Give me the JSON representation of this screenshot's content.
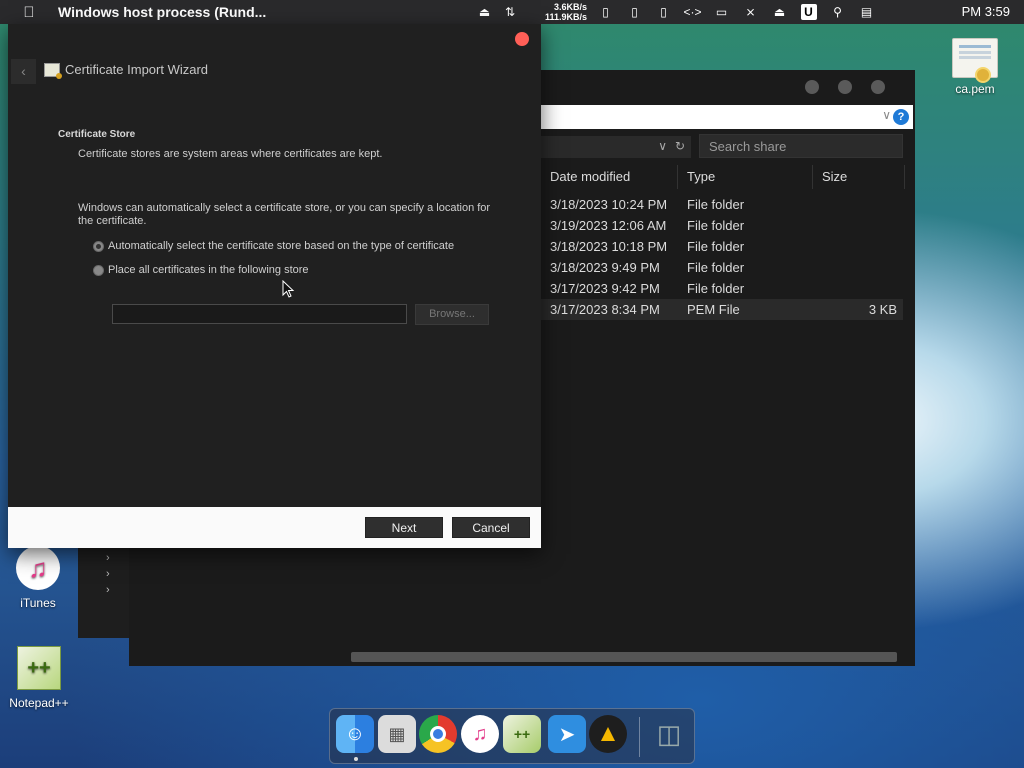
{
  "menubar": {
    "app_title": "Windows host process (Rund...",
    "upload_speed": "3.6KB/s",
    "download_speed": "111.9KB/s",
    "u_badge": "U",
    "clock": "PM 3:59"
  },
  "desktop": {
    "icons": [
      {
        "label": "ca.pem",
        "icon": "certificate-file-icon"
      },
      {
        "label": "iTunes",
        "icon": "itunes-icon"
      },
      {
        "label": "Notepad++",
        "icon": "notepad-plus-plus-icon"
      }
    ]
  },
  "explorer": {
    "search_placeholder": "Search share",
    "columns": [
      "Date modified",
      "Type",
      "Size"
    ],
    "rows": [
      {
        "date": "3/18/2023 10:24 PM",
        "type": "File folder",
        "size": ""
      },
      {
        "date": "3/19/2023 12:06 AM",
        "type": "File folder",
        "size": ""
      },
      {
        "date": "3/18/2023 10:18 PM",
        "type": "File folder",
        "size": ""
      },
      {
        "date": "3/18/2023 9:49 PM",
        "type": "File folder",
        "size": ""
      },
      {
        "date": "3/17/2023 9:42 PM",
        "type": "File folder",
        "size": ""
      },
      {
        "date": "3/17/2023 8:34 PM",
        "type": "PEM File",
        "size": "3 KB"
      }
    ]
  },
  "wizard": {
    "title": "Certificate Import Wizard",
    "section_title": "Certificate Store",
    "section_desc": "Certificate stores are system areas where certificates are kept.",
    "intro": "Windows can automatically select a certificate store, or you can specify a location for the certificate.",
    "option_auto": "Automatically select the certificate store based on the type of certificate",
    "option_manual": "Place all certificates in the following store",
    "selected_option": "auto",
    "store_value": "",
    "browse_label": "Browse...",
    "next_label": "Next",
    "cancel_label": "Cancel"
  },
  "dock": {
    "items": [
      "finder-icon",
      "launchpad-icon",
      "chrome-icon",
      "itunes-icon",
      "notepad-plus-plus-icon",
      "migration-icon",
      "vpn-icon",
      "trash-icon"
    ]
  },
  "colors": {
    "close_button": "#ff5f57",
    "help_badge": "#1f7ad6"
  }
}
